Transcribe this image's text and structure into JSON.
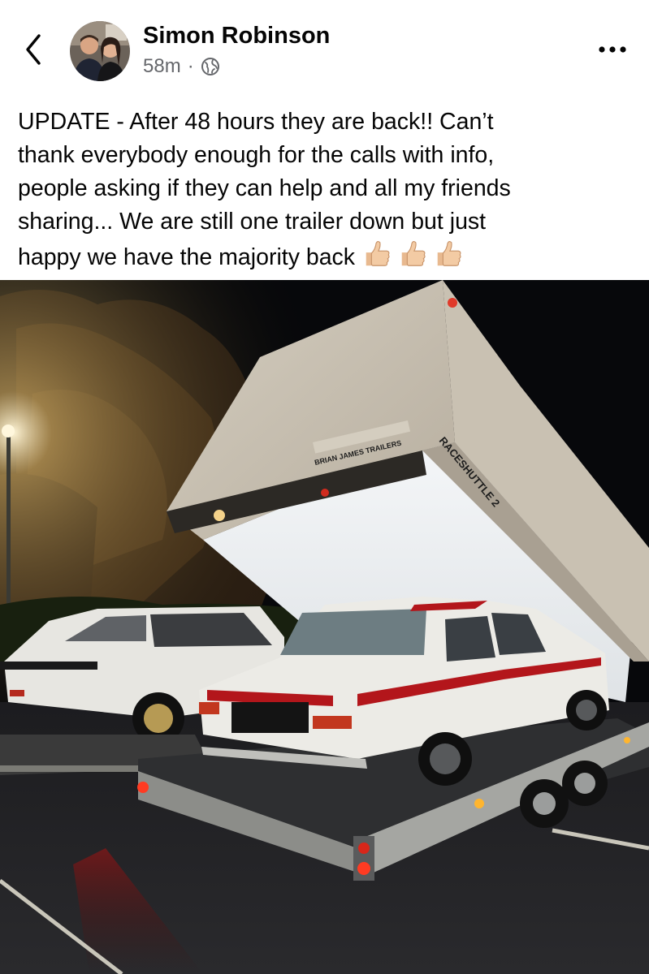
{
  "post": {
    "author_name": "Simon Robinson",
    "timestamp": "58m",
    "separator": "·",
    "privacy_icon": "globe-icon",
    "text_lines": [
      "UPDATE - After 48 hours they are back!! Can’t",
      "thank everybody enough for the calls with info,",
      "people asking if they can help and all my friends",
      "sharing... We are still one trailer down but just",
      "happy we have the majority back"
    ],
    "emoji": [
      "👍🏼",
      "👍🏼",
      "👍🏼"
    ]
  },
  "photo": {
    "trailer_brand": "BRIAN JAMES TRAILERS",
    "trailer_model": "RACESHUTTLE 2"
  },
  "icons": {
    "back": "chevron-left-icon",
    "more": "more-horizontal-icon",
    "thumbs": "thumbs-up-emoji-icon"
  },
  "colors": {
    "text": "#050505",
    "meta": "#65676b",
    "background": "#ffffff",
    "car_stripe": "#b3161b"
  }
}
